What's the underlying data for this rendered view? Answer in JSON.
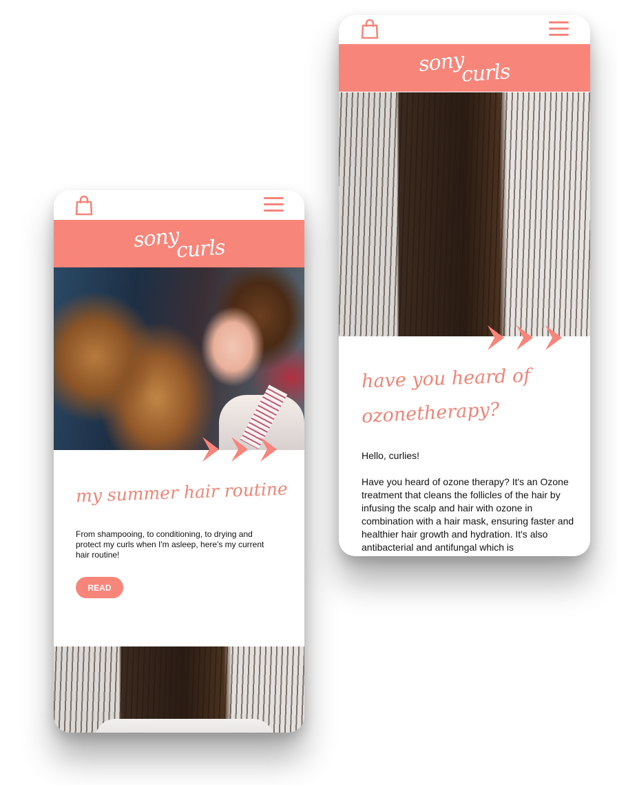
{
  "brand": {
    "name_part1": "sony",
    "name_part2": "curls",
    "accent_color": "#f8857a"
  },
  "icons": {
    "cart": "shopping-bag-icon",
    "menu": "hamburger-menu-icon",
    "next": "chevron-right-icon"
  },
  "left_screen": {
    "post_title": "my summer hair routine",
    "excerpt": "From shampooing, to conditioning, to drying and protect my curls when I'm asleep, here's my current hair routine!",
    "read_label": "READ"
  },
  "right_screen": {
    "post_title_line1": "have you heard of",
    "post_title_line2": "ozonetherapy?",
    "greeting": "Hello, curlies!",
    "paragraph": "Have you heard of ozone therapy? It's an Ozone treatment that cleans the follicles of the hair by infusing the scalp and hair with ozone in combination with a hair mask, ensuring faster and healthier hair growth and hydration. It's also antibacterial and antifungal which is"
  }
}
